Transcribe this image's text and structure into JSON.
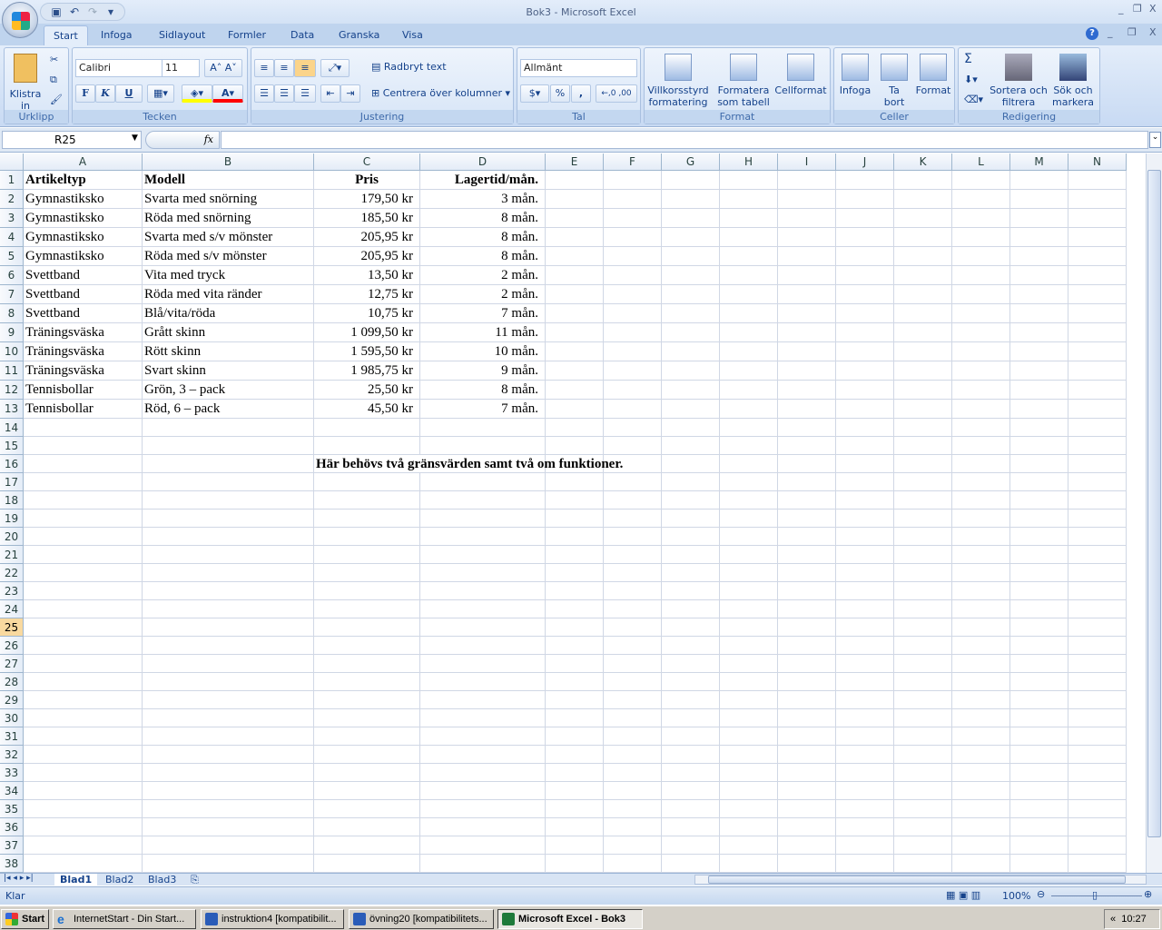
{
  "window": {
    "title": "Bok3 - Microsoft Excel"
  },
  "tabs": [
    "Start",
    "Infoga",
    "Sidlayout",
    "Formler",
    "Data",
    "Granska",
    "Visa"
  ],
  "ribbon": {
    "clipboard": {
      "label": "Urklipp",
      "paste": "Klistra in"
    },
    "font": {
      "label": "Tecken",
      "font_name": "Calibri",
      "font_size": "11",
      "bold": "F",
      "italic": "K",
      "underline": "U",
      "font_color": "#ff0000",
      "fill_color": "#ffff00"
    },
    "alignment": {
      "label": "Justering",
      "wrap": "Radbryt text",
      "merge": "Centrera över kolumner"
    },
    "number": {
      "label": "Tal",
      "format": "Allmänt",
      "percent": "%",
      "comma": ","
    },
    "styles": {
      "label": "Format",
      "conditional": "Villkorsstyrd formatering",
      "table": "Formatera som tabell",
      "cell": "Cellformat"
    },
    "cells": {
      "label": "Celler",
      "insert": "Infoga",
      "delete": "Ta bort",
      "format": "Format"
    },
    "editing": {
      "label": "Redigering",
      "sum": "Σ",
      "sort": "Sortera och filtrera",
      "find": "Sök och markera"
    }
  },
  "formula_bar": {
    "name_box": "R25",
    "fx": "fx",
    "formula": ""
  },
  "columns": [
    "A",
    "B",
    "C",
    "D",
    "E",
    "F",
    "G",
    "H",
    "I",
    "J",
    "K",
    "L",
    "M",
    "N"
  ],
  "selected_row": 25,
  "sheet": {
    "header": [
      "Artikeltyp",
      "Modell",
      "Pris",
      "Lagertid/mån."
    ],
    "rows": [
      [
        "Gymnastiksko",
        "Svarta med snörning",
        "179,50 kr",
        "3 mån."
      ],
      [
        "Gymnastiksko",
        "Röda med snörning",
        "185,50 kr",
        "8 mån."
      ],
      [
        "Gymnastiksko",
        "Svarta med s/v mönster",
        "205,95 kr",
        "8 mån."
      ],
      [
        "Gymnastiksko",
        "Röda med s/v mönster",
        "205,95 kr",
        "8 mån."
      ],
      [
        "Svettband",
        "Vita med tryck",
        "13,50 kr",
        "2 mån."
      ],
      [
        "Svettband",
        "Röda med vita ränder",
        "12,75 kr",
        "2 mån."
      ],
      [
        "Svettband",
        "Blå/vita/röda",
        "10,75 kr",
        "7 mån."
      ],
      [
        "Träningsväska",
        "Grått skinn",
        "1 099,50 kr",
        "11 mån."
      ],
      [
        "Träningsväska",
        "Rött skinn",
        "1 595,50 kr",
        "10 mån."
      ],
      [
        "Träningsväska",
        "Svart skinn",
        "1 985,75 kr",
        "9 mån."
      ],
      [
        "Tennisbollar",
        "Grön, 3 – pack",
        "25,50 kr",
        "8 mån."
      ],
      [
        "Tennisbollar",
        "Röd, 6 – pack",
        "45,50 kr",
        "7 mån."
      ]
    ],
    "note": "Här behövs två gränsvärden samt två om funktioner."
  },
  "sheet_tabs": [
    "Blad1",
    "Blad2",
    "Blad3"
  ],
  "status": {
    "ready": "Klar",
    "zoom": "100%"
  },
  "taskbar": {
    "start": "Start",
    "items": [
      "InternetStart - Din Start...",
      "instruktion4 [kompatibilit...",
      "övning20 [kompatibilitets...",
      "Microsoft Excel - Bok3"
    ],
    "clock": "10:27"
  }
}
